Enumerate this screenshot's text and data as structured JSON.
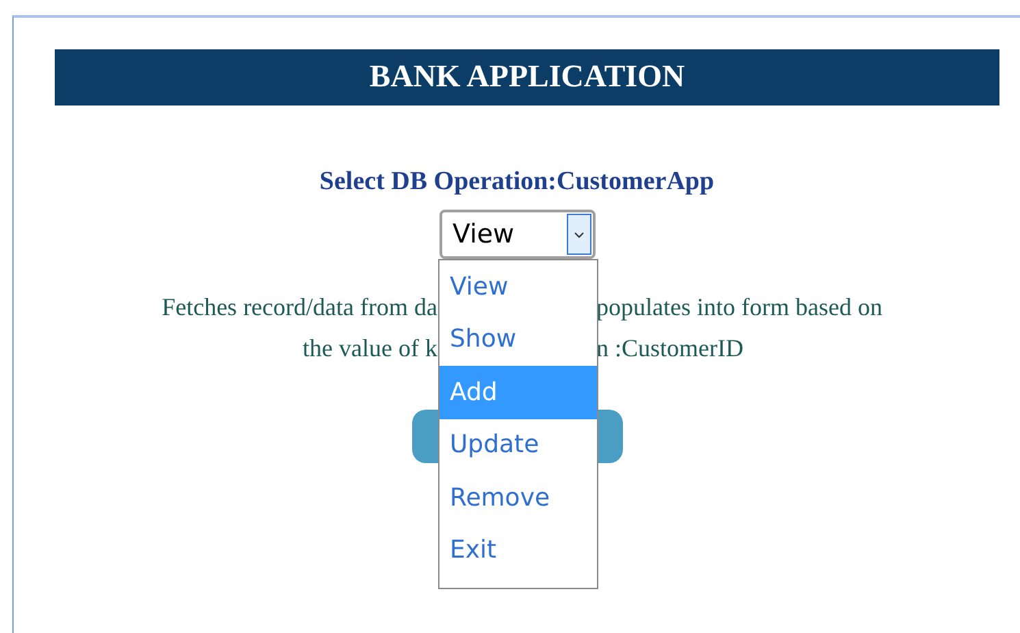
{
  "header": {
    "title": "BANK APPLICATION"
  },
  "operation_label": "Select DB Operation:CustomerApp",
  "operation_select": {
    "value": "View",
    "options": [
      {
        "label": "View",
        "highlighted": false
      },
      {
        "label": "Show",
        "highlighted": false
      },
      {
        "label": "Add",
        "highlighted": true
      },
      {
        "label": "Update",
        "highlighted": false
      },
      {
        "label": "Remove",
        "highlighted": false
      },
      {
        "label": "Exit",
        "highlighted": false
      }
    ]
  },
  "description": {
    "lines": [
      {
        "left": "Fetches record/data from da",
        "right": "populates into form based on"
      },
      {
        "left": "the value of k",
        "right": "n :CustomerID"
      }
    ]
  }
}
